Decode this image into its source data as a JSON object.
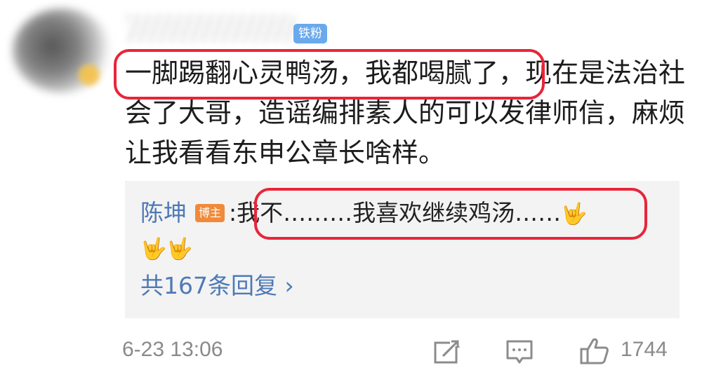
{
  "comment": {
    "badge": "铁粉",
    "text_highlight": "一脚踢翻心灵鸭汤，我都喝腻了",
    "text_rest": "，现在是法治社会了大哥，造谣编排素人的可以发律师信，麻烦让我看看东申公章长啥样。"
  },
  "reply": {
    "author": "陈坤",
    "author_badge": "博主",
    "separator": ":",
    "text": "我不………我喜欢继续鸡汤……",
    "emoji_inline": "🤟",
    "emoji_row": "🤟🤟",
    "count_label": "共167条回复 ›"
  },
  "footer": {
    "time": "6-23 13:06",
    "like_count": "1744",
    "icons": [
      "share-icon",
      "comment-icon",
      "like-icon"
    ]
  },
  "colors": {
    "highlight_border": "#e8253a",
    "link_blue": "#4e79b7",
    "fan_badge": "#6aa9ec",
    "host_badge": "#f08a3a"
  }
}
